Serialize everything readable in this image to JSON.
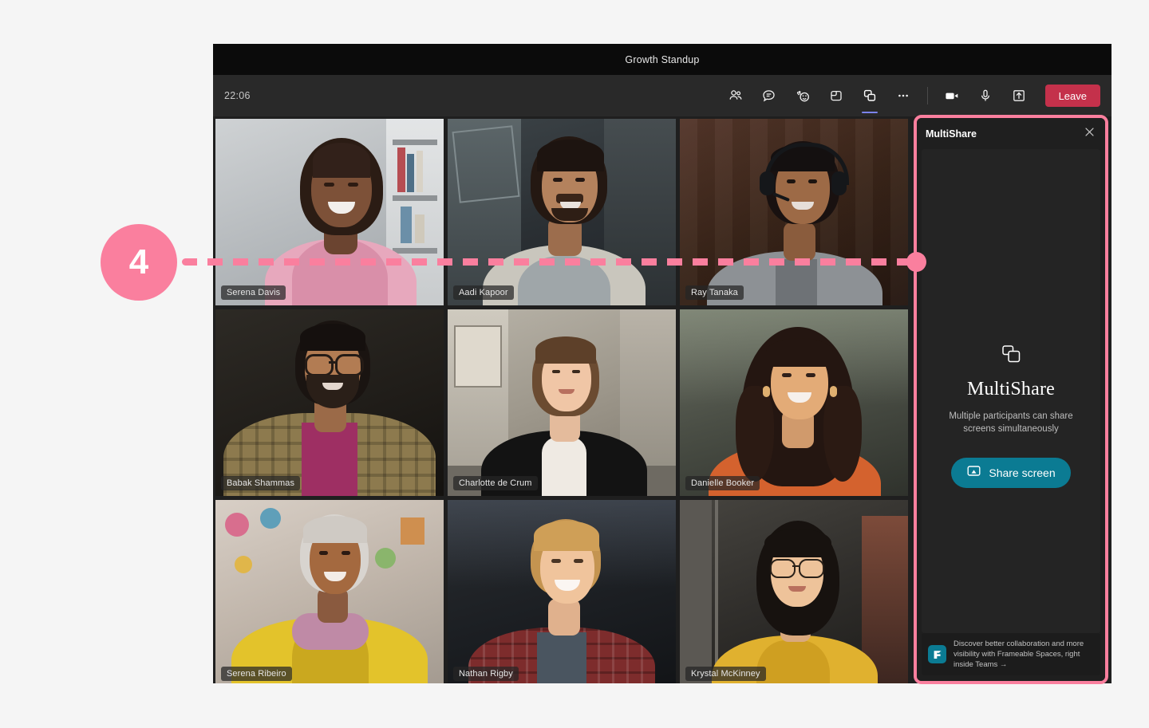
{
  "window": {
    "title": "Growth Standup",
    "timer": "22:06"
  },
  "toolbar": {
    "icons": [
      {
        "name": "people-icon",
        "label": "People"
      },
      {
        "name": "chat-icon",
        "label": "Chat"
      },
      {
        "name": "reactions-icon",
        "label": "Reactions"
      },
      {
        "name": "breakout-rooms-icon",
        "label": "Rooms"
      },
      {
        "name": "multishare-icon",
        "label": "MultiShare",
        "active": true
      },
      {
        "name": "more-options-icon",
        "label": "More"
      },
      {
        "name": "camera-icon",
        "label": "Camera"
      },
      {
        "name": "microphone-icon",
        "label": "Microphone"
      },
      {
        "name": "share-tray-icon",
        "label": "Share"
      }
    ],
    "leave_label": "Leave"
  },
  "grid": {
    "participants": [
      {
        "name": "Serena Davis"
      },
      {
        "name": "Aadi Kapoor"
      },
      {
        "name": "Ray Tanaka"
      },
      {
        "name": "Babak Shammas"
      },
      {
        "name": "Charlotte de Crum"
      },
      {
        "name": "Danielle Booker"
      },
      {
        "name": "Serena Ribeiro"
      },
      {
        "name": "Nathan Rigby"
      },
      {
        "name": "Krystal McKinney"
      }
    ]
  },
  "panel": {
    "title": "MultiShare",
    "close_label": "✕",
    "empty_title": "MultiShare",
    "empty_subtitle": "Multiple participants can share screens simultaneously",
    "share_button_label": "Share screen",
    "promo_text": "Discover better collaboration and more visibility with Frameable Spaces, right inside Teams →",
    "promo_logo_label": "Frameable"
  },
  "annotation": {
    "step_number": "4"
  },
  "colors": {
    "accent_pink": "#fa7f9e",
    "teal": "#0b7b93",
    "leave_red": "#c4314b",
    "active_underline": "#7b83eb"
  }
}
